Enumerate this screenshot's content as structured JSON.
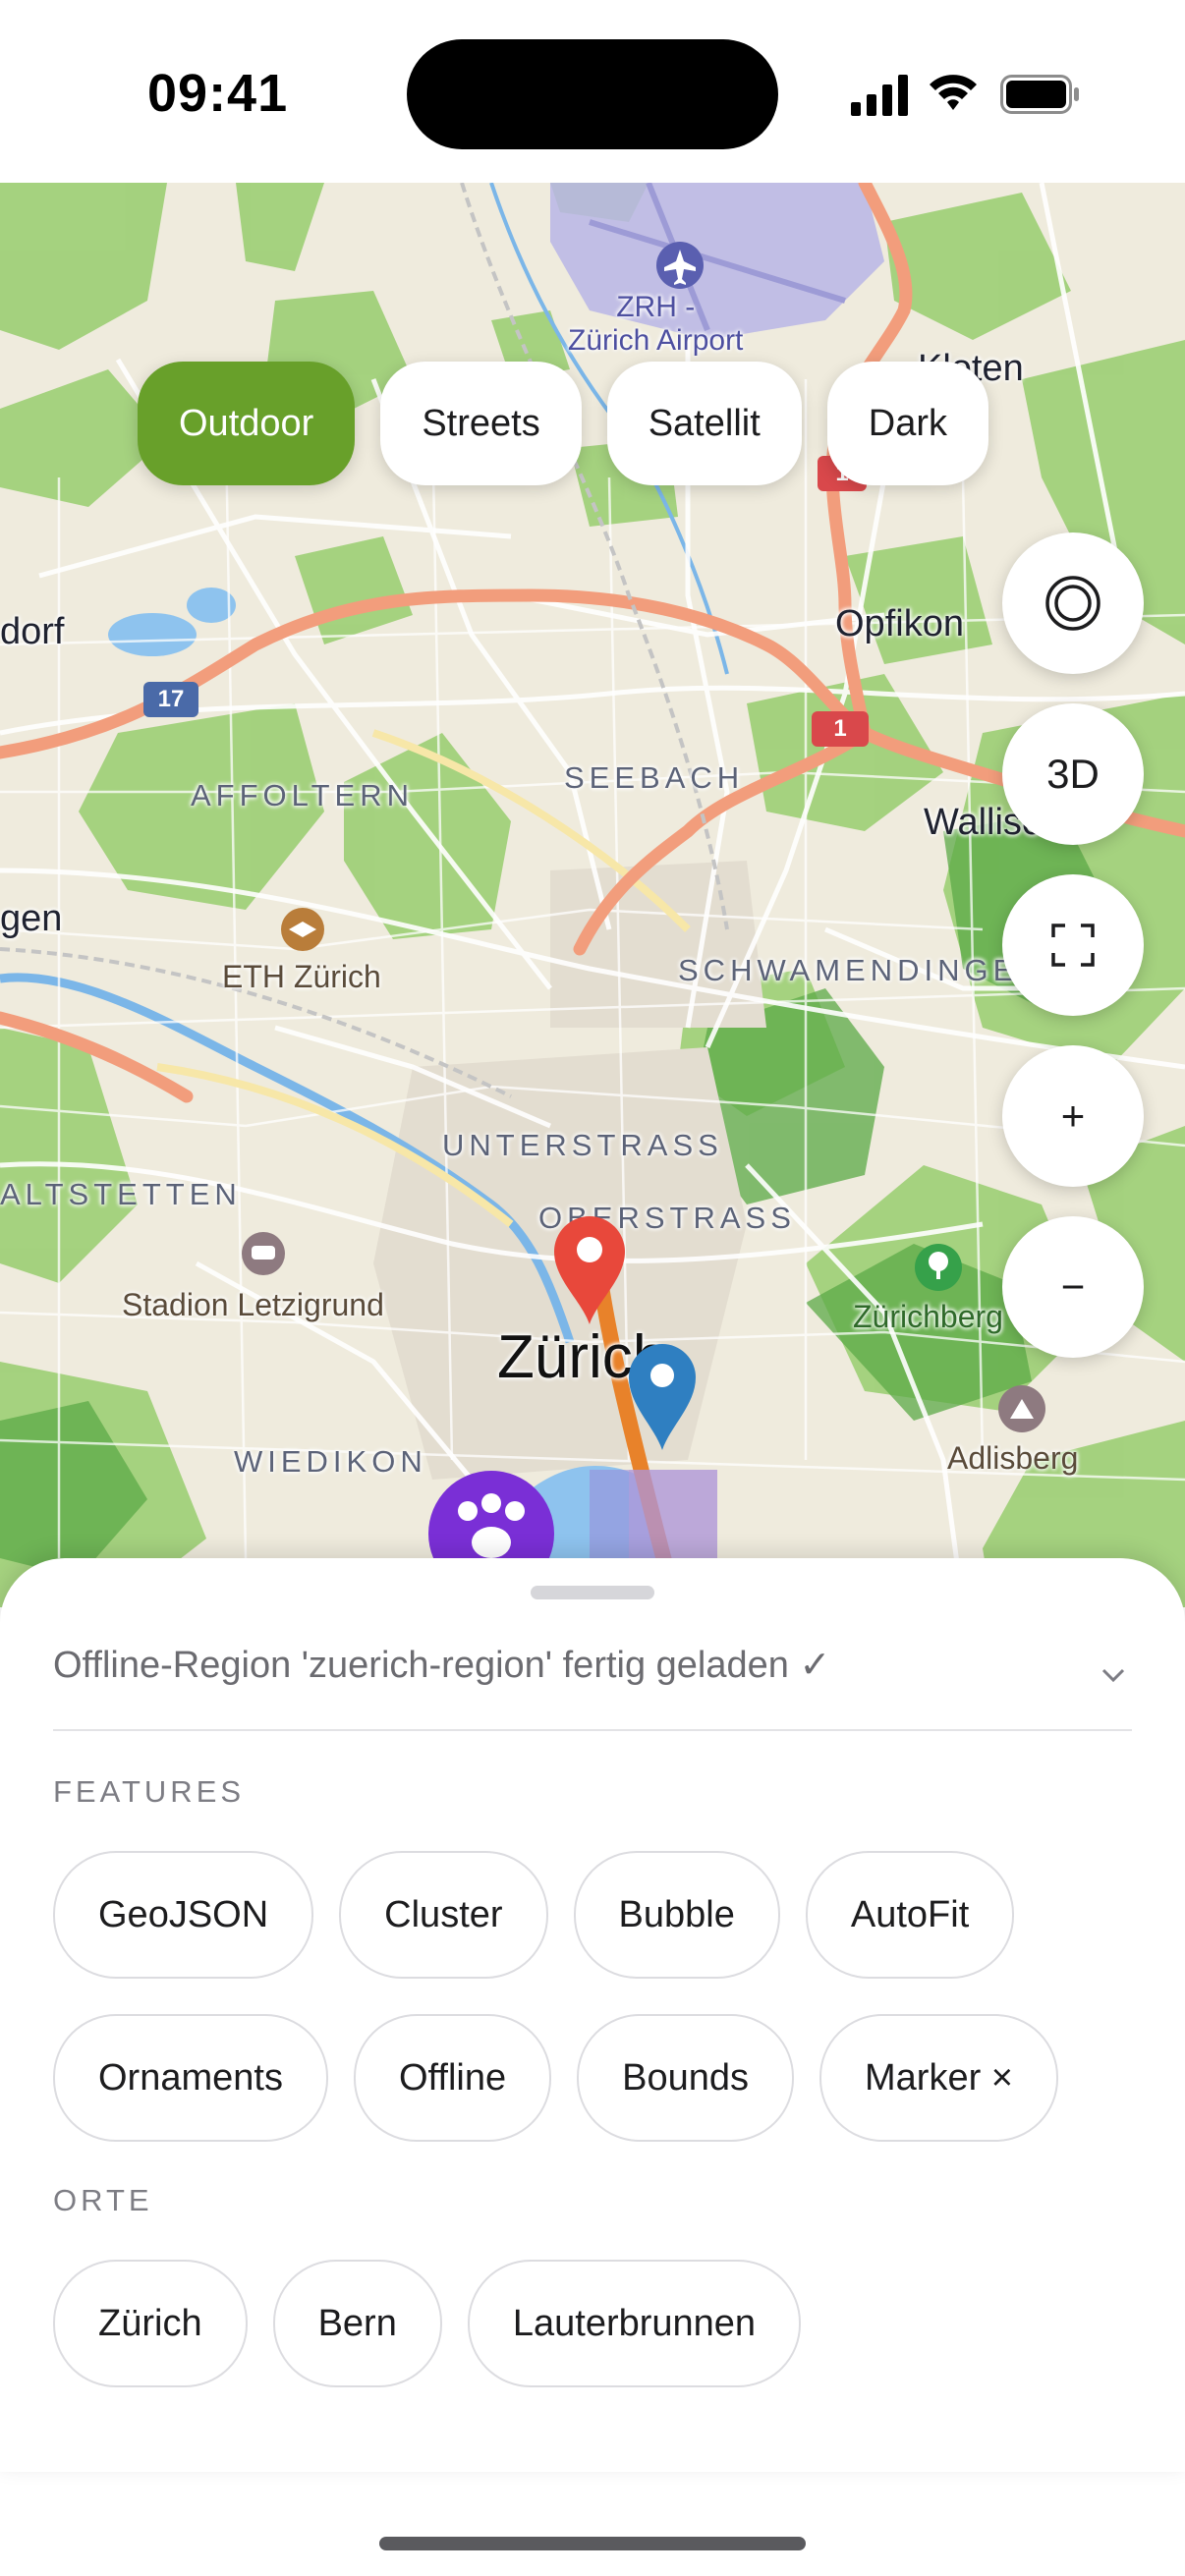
{
  "status_bar": {
    "time": "09:41"
  },
  "map": {
    "style_chips": [
      {
        "label": "Outdoor",
        "active": true
      },
      {
        "label": "Streets",
        "active": false
      },
      {
        "label": "Satellit",
        "active": false
      },
      {
        "label": "Dark",
        "active": false
      }
    ],
    "controls": {
      "threed_label": "3D",
      "zoom_in_label": "+",
      "zoom_out_label": "−"
    },
    "labels": {
      "airport": "ZRH -\nZürich Airport",
      "opfikon": "Opfikon",
      "kloten": "Kloten",
      "dorf": "dorf",
      "affoltern": "AFFOLTERN",
      "seebach": "SEEBACH",
      "wallisellen": "Wallisellen",
      "gen": "gen",
      "eth": "ETH Zürich",
      "schwamendingen": "SCHWAMENDINGEN",
      "unterstrass": "UNTERSTRASS",
      "oberstrass": "OBERSTRASS",
      "altstetten": "ALTSTETTEN",
      "letzigrund": "Stadion Letzigrund",
      "zuerichberg": "Zürichberg",
      "zuerich": "Zürich",
      "adlisberg": "Adlisberg",
      "wiedikon": "WIEDIKON"
    },
    "shields": {
      "road17": "17",
      "road1a": "1",
      "road1b": "1"
    },
    "colors": {
      "active_chip": "#68a02a",
      "marker_red": "#e8483b",
      "marker_blue": "#2f7fc1",
      "cluster_purple": "#7a2fd6",
      "route_orange": "#e8822a"
    }
  },
  "sheet": {
    "status_message": "Offline-Region 'zuerich-region' fertig geladen ✓",
    "features_title": "FEATURES",
    "features": [
      "GeoJSON",
      "Cluster",
      "Bubble",
      "AutoFit",
      "Ornaments",
      "Offline",
      "Bounds",
      "Marker ×"
    ],
    "places_title": "ORTE",
    "places": [
      "Zürich",
      "Bern",
      "Lauterbrunnen"
    ]
  }
}
